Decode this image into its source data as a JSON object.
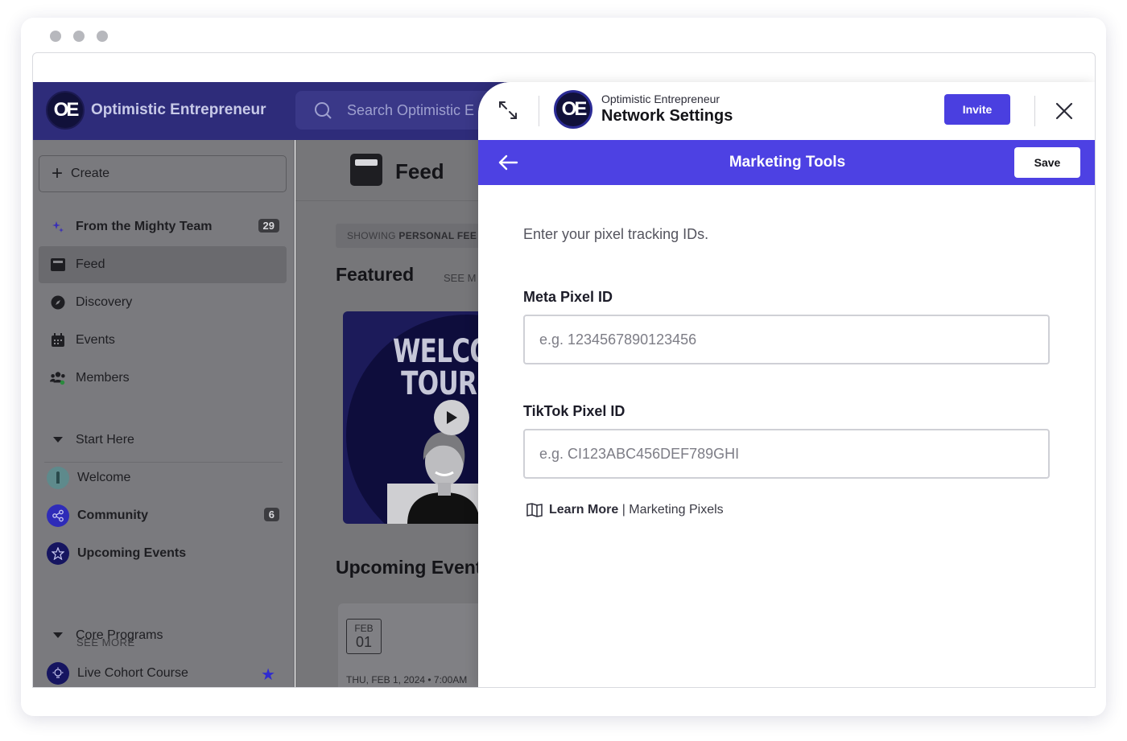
{
  "app": {
    "brand_initials": "OE",
    "brand_name": "Optimistic Entrepreneur",
    "search_placeholder": "Search Optimistic E",
    "create_label": "Create"
  },
  "sidebar": {
    "items": [
      {
        "label": "From the Mighty Team",
        "badge": "29"
      },
      {
        "label": "Feed"
      },
      {
        "label": "Discovery"
      },
      {
        "label": "Events"
      },
      {
        "label": "Members"
      }
    ],
    "start_here": {
      "header": "Start Here",
      "items": [
        {
          "label": "Welcome"
        },
        {
          "label": "Community",
          "badge": "6"
        },
        {
          "label": "Upcoming Events"
        }
      ],
      "see_more": "SEE MORE"
    },
    "core_programs": {
      "header": "Core Programs",
      "items": [
        {
          "label": "Live Cohort Course"
        }
      ]
    }
  },
  "main": {
    "title": "Feed",
    "showing_prefix": "SHOWING ",
    "showing_bold": "PERSONAL FEE",
    "featured": "Featured",
    "see_more": "SEE M",
    "video_title": "WELCO\n TOUR",
    "upcoming": "Upcoming Events",
    "event": {
      "month": "FEB",
      "day": "01",
      "datetime": "THU, FEB 1, 2024 • 7:00AM"
    }
  },
  "drawer": {
    "network_name": "Optimistic Entrepreneur",
    "title": "Network Settings",
    "invite_label": "Invite",
    "bar_title": "Marketing Tools",
    "save_label": "Save",
    "intro": "Enter your pixel tracking IDs.",
    "meta": {
      "label": "Meta Pixel ID",
      "placeholder": "e.g. 1234567890123456",
      "value": ""
    },
    "tiktok": {
      "label": "TikTok Pixel ID",
      "placeholder": "e.g. CI123ABC456DEF789GHI",
      "value": ""
    },
    "learn_more": "Learn More",
    "learn_sep": " | ",
    "learn_topic": "Marketing Pixels"
  },
  "colors": {
    "brand_dark": "#2e2c7a",
    "accent": "#4d41e3",
    "invite": "#4a3fe0",
    "star": "#2f2bd0"
  },
  "icons": [
    "expand-icon",
    "close-icon",
    "back-arrow-icon",
    "search-icon",
    "plus-icon",
    "sparkle-icon",
    "feed-icon",
    "compass-icon",
    "calendar-icon",
    "members-icon",
    "caret-down-icon",
    "play-icon",
    "star-icon",
    "book-icon"
  ]
}
